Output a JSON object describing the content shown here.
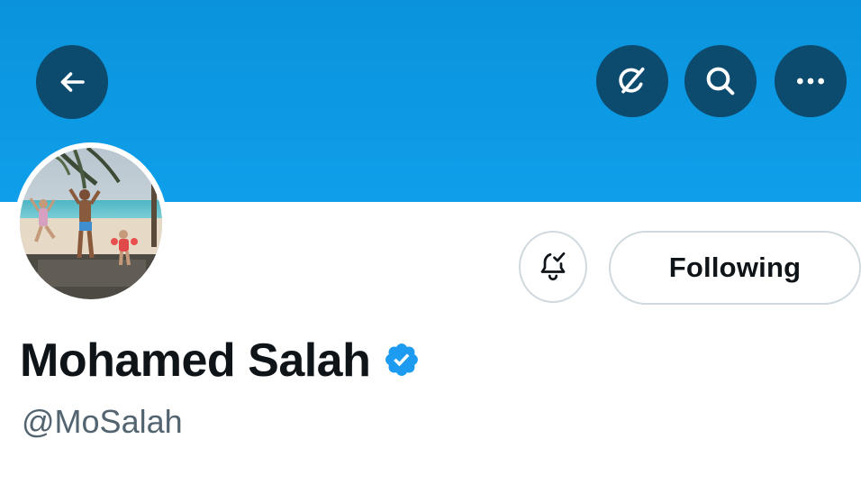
{
  "colors": {
    "banner": "#0f9fea",
    "icon_button_bg": "#0c4a6e",
    "verified_badge": "#1d9bf0",
    "text_primary": "#0f1419",
    "text_secondary": "#536471",
    "border": "#cfd9de"
  },
  "header": {
    "back_icon": "arrow-left-icon",
    "grok_icon": "grok-icon",
    "search_icon": "search-icon",
    "more_icon": "more-horizontal-icon"
  },
  "profile": {
    "display_name": "Mohamed Salah",
    "handle": "@MoSalah",
    "verified": true,
    "verified_icon": "verified-badge-icon",
    "avatar": "family-beach-photo"
  },
  "actions": {
    "notifications_icon": "bell-check-icon",
    "following_label": "Following"
  }
}
